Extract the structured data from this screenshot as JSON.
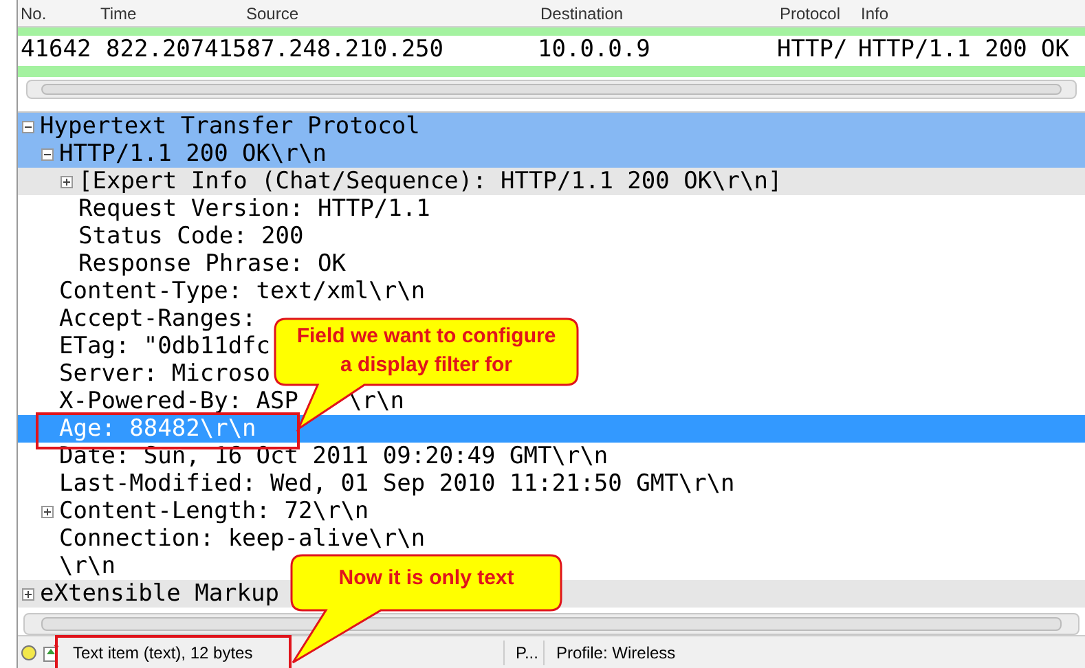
{
  "packet_list": {
    "columns": [
      "No.",
      "Time",
      "Source",
      "Destination",
      "Protocol",
      "Info"
    ],
    "row": {
      "no": "41642",
      "time": "822.20741",
      "source": "587.248.210.250",
      "destination": "10.0.0.9",
      "protocol": "HTTP/",
      "info": "HTTP/1.1 200 OK"
    }
  },
  "details": [
    {
      "text": "Hypertext Transfer Protocol",
      "kind": "path",
      "selected": false,
      "expanded": true,
      "children": [
        {
          "text": "HTTP/1.1 200 OK\\r\\n",
          "kind": "path",
          "selected": false,
          "expanded": true,
          "children": [
            {
              "text": "[Expert Info (Chat/Sequence): HTTP/1.1 200 OK\\r\\n]",
              "kind": "expert",
              "selected": false,
              "expanded": false
            },
            {
              "text": "Request Version: HTTP/1.1",
              "kind": "plain",
              "selected": false
            },
            {
              "text": "Status Code: 200",
              "kind": "plain",
              "selected": false
            },
            {
              "text": "Response Phrase: OK",
              "kind": "plain",
              "selected": false
            }
          ]
        },
        {
          "text": "Content-Type: text/xml\\r\\n",
          "kind": "plain",
          "selected": false
        },
        {
          "text": "Accept-Ranges:",
          "kind": "plain",
          "selected": false
        },
        {
          "text": "ETag: \"0db11dfc",
          "kind": "plain",
          "selected": false
        },
        {
          "text": "Server: Microso",
          "kind": "plain",
          "selected": false
        },
        {
          "text": "X-Powered-By: ASP",
          "trailing": "\\r\\n",
          "kind": "plain",
          "selected": false
        },
        {
          "text": "Age: 88482\\r\\n",
          "selected": true
        },
        {
          "text": "Date: Sun, 16 Oct 2011 09:20:49 GMT\\r\\n",
          "kind": "plain",
          "selected": false
        },
        {
          "text": "Last-Modified: Wed, 01 Sep 2010 11:21:50 GMT\\r\\n",
          "kind": "plain",
          "selected": false
        },
        {
          "text": "Content-Length: 72\\r\\n",
          "kind": "plain",
          "selected": false,
          "expanded": false
        },
        {
          "text": "Connection: keep-alive\\r\\n",
          "kind": "plain",
          "selected": false
        },
        {
          "text": "\\r\\n",
          "kind": "plain",
          "selected": false
        }
      ]
    },
    {
      "text": "eXtensible Markup",
      "kind": "hover",
      "selected": false,
      "expanded": false
    }
  ],
  "status_bar": {
    "field_info": "Text item (text), 12 bytes",
    "packets": "P...",
    "profile": "Profile: Wireless"
  },
  "callouts": [
    "Field we want to configure a display filter for",
    "Now it is only text"
  ]
}
